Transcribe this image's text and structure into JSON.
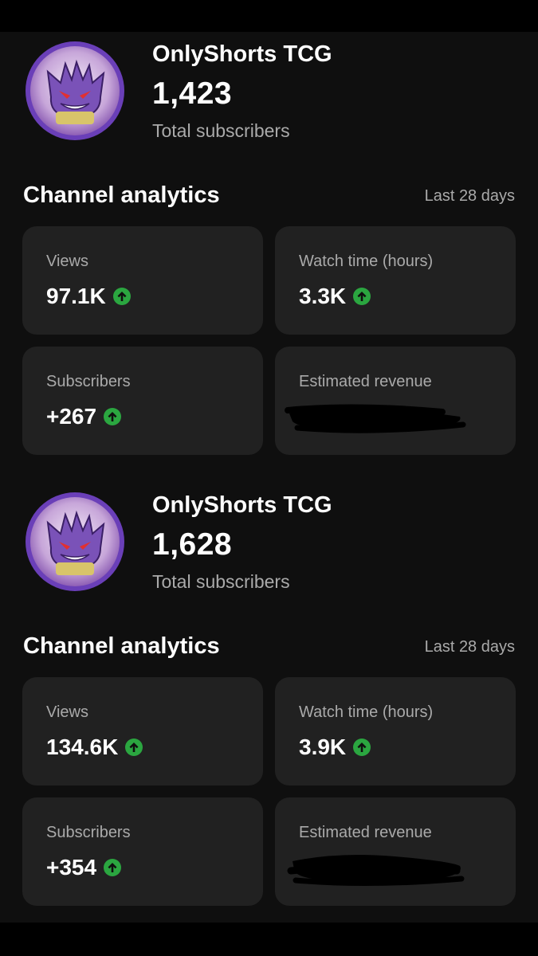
{
  "colors": {
    "background": "#0f0f0f",
    "card": "#212121",
    "secondary_text": "#aaaaaa",
    "up_arrow": "#2ba640",
    "avatar_ring": "#6a3fb8"
  },
  "snapshots": [
    {
      "channel": {
        "name": "OnlyShorts TCG",
        "subscriber_count": "1,423",
        "subscriber_label": "Total subscribers"
      },
      "analytics": {
        "title": "Channel analytics",
        "period": "Last 28 days",
        "cards": [
          {
            "label": "Views",
            "value": "97.1K",
            "trend_icon": "arrow-up-circle-icon"
          },
          {
            "label": "Watch time (hours)",
            "value": "3.3K",
            "trend_icon": "arrow-up-circle-icon"
          },
          {
            "label": "Subscribers",
            "value": "+267",
            "trend_icon": "arrow-up-circle-icon"
          },
          {
            "label": "Estimated revenue",
            "value": null
          }
        ]
      }
    },
    {
      "channel": {
        "name": "OnlyShorts TCG",
        "subscriber_count": "1,628",
        "subscriber_label": "Total subscribers"
      },
      "analytics": {
        "title": "Channel analytics",
        "period": "Last 28 days",
        "cards": [
          {
            "label": "Views",
            "value": "134.6K",
            "trend_icon": "arrow-up-circle-icon"
          },
          {
            "label": "Watch time (hours)",
            "value": "3.9K",
            "trend_icon": "arrow-up-circle-icon"
          },
          {
            "label": "Subscribers",
            "value": "+354",
            "trend_icon": "arrow-up-circle-icon"
          },
          {
            "label": "Estimated revenue",
            "value": null
          }
        ]
      }
    }
  ]
}
